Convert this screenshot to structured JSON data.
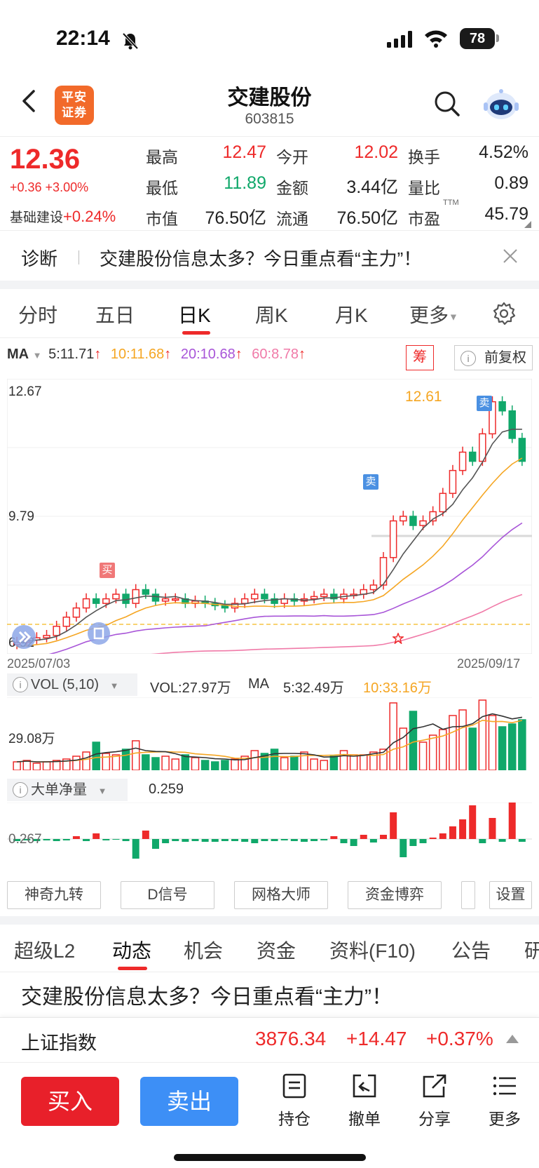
{
  "status_bar": {
    "time": "22:14",
    "battery": "78"
  },
  "header": {
    "logo_line1": "平安",
    "logo_line2": "证券",
    "stock_name": "交建股份",
    "stock_code": "603815"
  },
  "quote": {
    "price": "12.36",
    "change": "+0.36 +3.00%",
    "sector_name": "基础建设",
    "sector_change": "+0.24%",
    "fields": [
      {
        "label": "最高",
        "value": "12.47",
        "color": "red"
      },
      {
        "label": "今开",
        "value": "12.02",
        "color": "red"
      },
      {
        "label": "换手",
        "value": "4.52%",
        "color": "black"
      },
      {
        "label": "最低",
        "value": "11.89",
        "color": "green"
      },
      {
        "label": "金额",
        "value": "3.44亿",
        "color": "black"
      },
      {
        "label": "量比",
        "value": "0.89",
        "color": "black"
      },
      {
        "label": "市值",
        "value": "76.50亿",
        "color": "black"
      },
      {
        "label": "流通",
        "value": "76.50亿",
        "color": "black"
      },
      {
        "label": "市盈",
        "value": "45.79",
        "color": "black"
      }
    ],
    "pe_suffix": "TTM"
  },
  "diagnosis": {
    "label": "诊断",
    "text": "交建股份信息太多？今日重点看“主力”！"
  },
  "period_tabs": [
    "分时",
    "五日",
    "日K",
    "周K",
    "月K",
    "更多"
  ],
  "ma": {
    "label": "MA",
    "ma5": "5:11.71",
    "ma10": "10:11.68",
    "ma20": "20:10.68",
    "ma60": "60:8.78",
    "up_arrow": "↑",
    "colors": {
      "ma5": "#333333",
      "ma10": "#f5a623",
      "ma20": "#a855d8",
      "ma60": "#f07aa8"
    }
  },
  "chart_controls": {
    "chou": "筹",
    "fuquan": "前复权"
  },
  "kline": {
    "y_top": "12.67",
    "y_mid": "9.79",
    "y_low": "6.92",
    "high_mark": "12.61",
    "date_start": "2025/07/03",
    "date_end": "2025/09/17",
    "buy_mark": "买",
    "sell_mark": "卖"
  },
  "volume": {
    "indicator": "VOL (5,10)",
    "vol": "VOL:27.97万",
    "ma_label": "MA",
    "ma5": "5:32.49万",
    "ma10": "10:33.16万",
    "axis": "29.08万"
  },
  "big_order": {
    "indicator": "大单净量",
    "value": "0.259",
    "axis": "0.267"
  },
  "tools": [
    "神奇九转",
    "D信号",
    "网格大师",
    "资金博弈",
    "设置"
  ],
  "info_tabs": [
    "超级L2",
    "动态",
    "机会",
    "资金",
    "资料(F10)",
    "公告",
    "研"
  ],
  "news_headline": "交建股份信息太多？今日重点看“主力”！",
  "index_bar": {
    "name": "上证指数",
    "value": "3876.34",
    "change": "+14.47",
    "change_pct": "+0.37%"
  },
  "bottom": {
    "buy": "买入",
    "sell": "卖出",
    "hold": "持仓",
    "cancel": "撤单",
    "share": "分享",
    "more": "更多"
  }
}
